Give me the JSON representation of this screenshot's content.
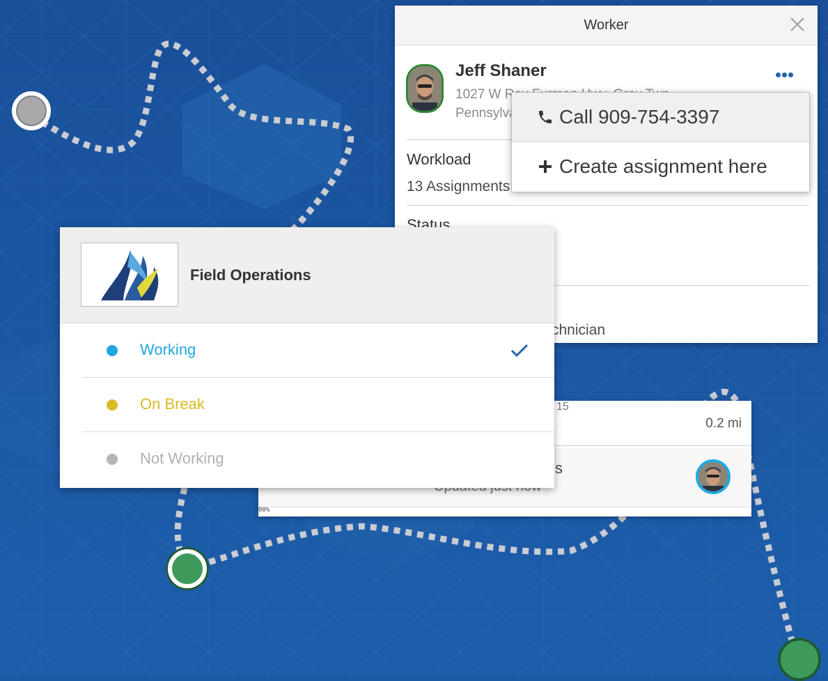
{
  "colors": {
    "background": "#1c59a4",
    "route": "#c9ccd3",
    "working": "#1fa6e0",
    "on_break": "#d8bb26",
    "not_working": "#b6b6b6",
    "accent": "#2464a8",
    "avatar_online": "#2e8a34",
    "marker_start": "#a9a9a9",
    "marker_active": "#3d9a5b"
  },
  "worker_panel": {
    "title": "Worker",
    "close_icon": "close-icon",
    "name": "Jeff Shaner",
    "address_line1": "1027 W Roy Furman Hwy, Gray Twp,",
    "address_line2": "Pennsylvania",
    "more_icon": "more-dots-icon",
    "workload_label": "Workload",
    "workload_value": "13 Assignments",
    "status_label": "Status",
    "title_value_fragment": "chnician"
  },
  "action_menu": {
    "call_label": "Call 909-754-3397",
    "call_icon": "phone-icon",
    "create_label": "Create assignment here",
    "create_icon": "plus-icon"
  },
  "assignment_card": {
    "row1_fragment": "15",
    "distance": "0.2 mi",
    "row2_fragment": "s",
    "updated": "Updated just now",
    "zoom": "00%"
  },
  "status_panel": {
    "app_name": "Field Operations",
    "logo_icon": "field-operations-logo",
    "statuses": [
      {
        "label": "Working",
        "selected": true
      },
      {
        "label": "On Break",
        "selected": false
      },
      {
        "label": "Not Working",
        "selected": false
      }
    ]
  }
}
